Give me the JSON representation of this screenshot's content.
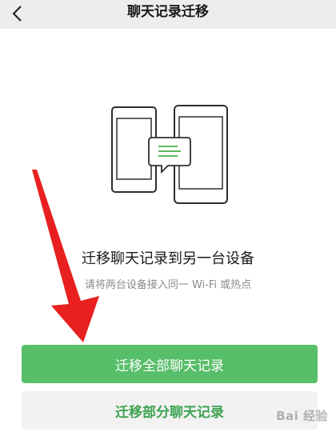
{
  "nav": {
    "title": "聊天记录迁移",
    "back_icon": "chevron-left-icon"
  },
  "illustration": {
    "icon": "phones-transfer-icon",
    "accent_color": "#5cb85c"
  },
  "main": {
    "heading": "迁移聊天记录到另一台设备",
    "subtext": "请将两台设备接入同一 Wi-Fi 或热点"
  },
  "buttons": {
    "migrate_all": "迁移全部聊天记录",
    "migrate_partial": "迁移部分聊天记录"
  },
  "colors": {
    "primary": "#57be6a",
    "secondary_bg": "#f2f2f2",
    "secondary_text": "#3da351",
    "arrow": "#e8201f"
  },
  "watermark": {
    "text": "Bai 经验"
  }
}
